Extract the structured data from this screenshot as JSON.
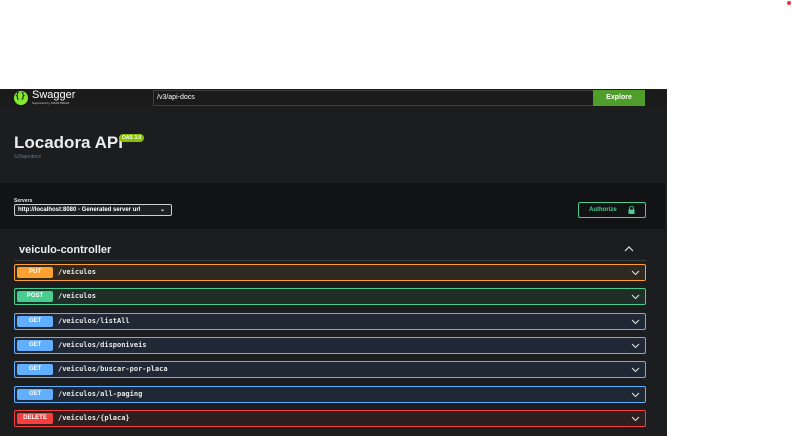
{
  "topbar": {
    "logo_name": "Swagger",
    "logo_sub": "Supported by SMARTBEAR",
    "url_value": "/v3/api-docs",
    "explore_label": "Explore"
  },
  "info": {
    "title": "Locadora API",
    "oas_badge": "OAS 3.0",
    "link": "/v3/api-docs"
  },
  "servers": {
    "label": "Servers",
    "selected": "http://localhost:8080 - Generated server url",
    "authorize_label": "Authorize"
  },
  "tag": {
    "name": "veiculo-controller"
  },
  "operations": [
    {
      "method": "PUT",
      "path": "/veiculos"
    },
    {
      "method": "POST",
      "path": "/veiculos"
    },
    {
      "method": "GET",
      "path": "/veiculos/listAll"
    },
    {
      "method": "GET",
      "path": "/veiculos/disponiveis"
    },
    {
      "method": "GET",
      "path": "/veiculos/buscar-por-placa"
    },
    {
      "method": "GET",
      "path": "/veiculos/all-paging"
    },
    {
      "method": "DELETE",
      "path": "/veiculos/{placa}"
    }
  ],
  "colors": {
    "put": "#fca130",
    "post": "#49cc90",
    "get": "#61affe",
    "delete": "#f93e3e",
    "explore": "#4f9d2a",
    "oas": "#89bf04",
    "background": "#1c1d1f"
  },
  "icons": {
    "logo": "swagger-logo-icon",
    "lock": "lock-icon",
    "chevron_up": "chevron-up-icon",
    "chevron_down": "chevron-down-icon"
  }
}
